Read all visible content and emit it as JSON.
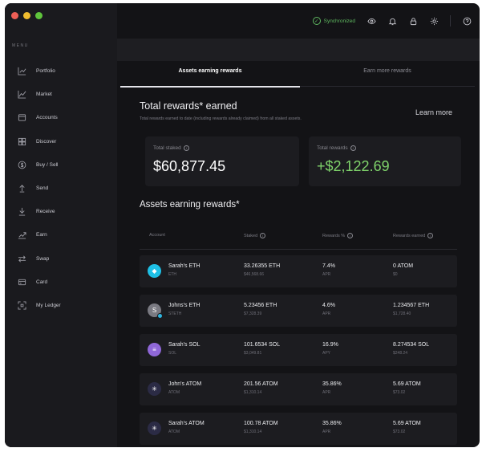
{
  "colors": {
    "window_bg": "#131316",
    "sidebar_bg": "#1a1a1e",
    "accent_green": "#7fd36b",
    "sync_green": "#5fb860"
  },
  "sidebar": {
    "menu_label": "MENU",
    "items": [
      {
        "label": "Portfolio",
        "icon": "portfolio-chart-icon"
      },
      {
        "label": "Market",
        "icon": "market-trend-icon"
      },
      {
        "label": "Accounts",
        "icon": "wallet-icon"
      },
      {
        "label": "Discover",
        "icon": "grid-icon"
      },
      {
        "label": "Buy / Sell",
        "icon": "dollar-circle-icon"
      },
      {
        "label": "Send",
        "icon": "arrow-up-icon"
      },
      {
        "label": "Receive",
        "icon": "arrow-down-icon"
      },
      {
        "label": "Earn",
        "icon": "earn-chart-icon"
      },
      {
        "label": "Swap",
        "icon": "swap-arrows-icon"
      },
      {
        "label": "Card",
        "icon": "card-icon"
      },
      {
        "label": "My Ledger",
        "icon": "ledger-icon"
      }
    ]
  },
  "topbar": {
    "sync_status": "Synchronized"
  },
  "tabs": {
    "active": "Assets earning rewards",
    "inactive": "Earn more rewards"
  },
  "rewards": {
    "title": "Total rewards* earned",
    "subtitle": "Total rewards earned to date (including rewards already claimed) from all staked assets.",
    "learn_more": "Learn more",
    "total_staked_label": "Total staked",
    "total_staked_value": "$60,877.45",
    "total_rewards_label": "Total rewards",
    "total_rewards_value": "+$2,122.69"
  },
  "assets": {
    "title": "Assets earning rewards*",
    "columns": [
      "Account",
      "Staked",
      "Rewards %",
      "Rewards earned"
    ],
    "rows": [
      {
        "name": "Sarah's ETH",
        "ticker": "ETH",
        "staked": "33.26355 ETH",
        "staked_fiat": "$46,568.66",
        "rate": "7.4%",
        "rate_label": "APR",
        "earned": "0 ATOM",
        "earned_fiat": "$0",
        "icon_color": "#1ec0e6",
        "icon_glyph": "◆"
      },
      {
        "name": "Johns's ETH",
        "ticker": "STETH",
        "staked": "5.23456 ETH",
        "staked_fiat": "$7,328.39",
        "rate": "4.6%",
        "rate_label": "APR",
        "earned": "1.234567 ETH",
        "earned_fiat": "$1,728.40",
        "icon_color": "#7a7a82",
        "icon_glyph": "S"
      },
      {
        "name": "Sarah's SOL",
        "ticker": "SOL",
        "staked": "101.6534 SOL",
        "staked_fiat": "$3,049.81",
        "rate": "16.9%",
        "rate_label": "APY",
        "earned": "8.274534 SOL",
        "earned_fiat": "$248.24",
        "icon_color": "#8f67d8",
        "icon_glyph": "≡"
      },
      {
        "name": "John's ATOM",
        "ticker": "ATOM",
        "staked": "201.56 ATOM",
        "staked_fiat": "$1,310.14",
        "rate": "35.86%",
        "rate_label": "APR",
        "earned": "5.69 ATOM",
        "earned_fiat": "$73.02",
        "icon_color": "#2b2b45",
        "icon_glyph": "✳"
      },
      {
        "name": "Sarah's ATOM",
        "ticker": "ATOM",
        "staked": "100.78 ATOM",
        "staked_fiat": "$1,310.14",
        "rate": "35.86%",
        "rate_label": "APR",
        "earned": "5.69 ATOM",
        "earned_fiat": "$73.02",
        "icon_color": "#2b2b45",
        "icon_glyph": "✳"
      }
    ]
  }
}
